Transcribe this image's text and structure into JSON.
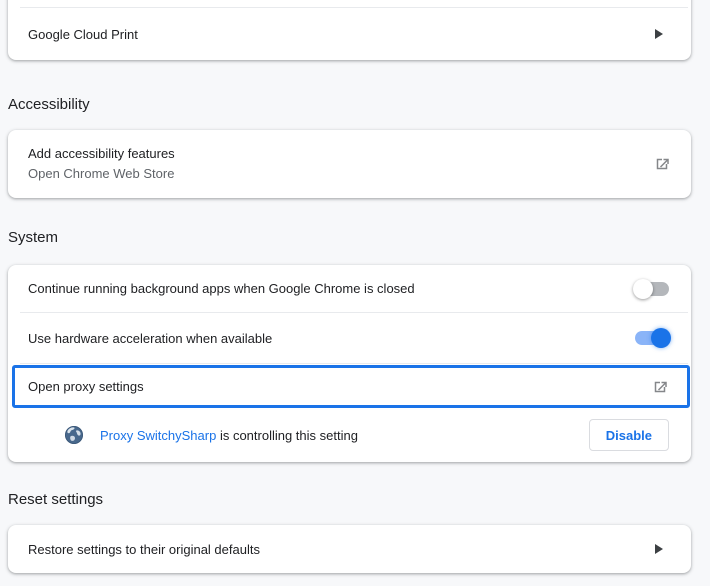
{
  "colors": {
    "accent_blue": "#1a73e8",
    "toggle_on_track": "#8ab4f8",
    "toggle_off_track": "#b4b7bb",
    "page_background": "#f7f8fa",
    "secondary_text": "#5f6368",
    "focus_ring": "#1a73e8"
  },
  "google_cloud_print": {
    "label": "Google Cloud Print"
  },
  "accessibility": {
    "heading": "Accessibility",
    "row_title": "Add accessibility features",
    "row_subtitle": "Open Chrome Web Store"
  },
  "system": {
    "heading": "System",
    "background_apps": {
      "label": "Continue running background apps when Google Chrome is closed",
      "toggle_state": "off"
    },
    "hardware_accel": {
      "label": "Use hardware acceleration when available",
      "toggle_state": "on"
    },
    "proxy": {
      "label": "Open proxy settings",
      "highlighted": true
    },
    "extension_indicator": {
      "extension_name": "Proxy SwitchySharp",
      "suffix_text": " is controlling this setting",
      "button_label": "Disable"
    }
  },
  "reset": {
    "heading": "Reset settings",
    "row_label": "Restore settings to their original defaults"
  }
}
